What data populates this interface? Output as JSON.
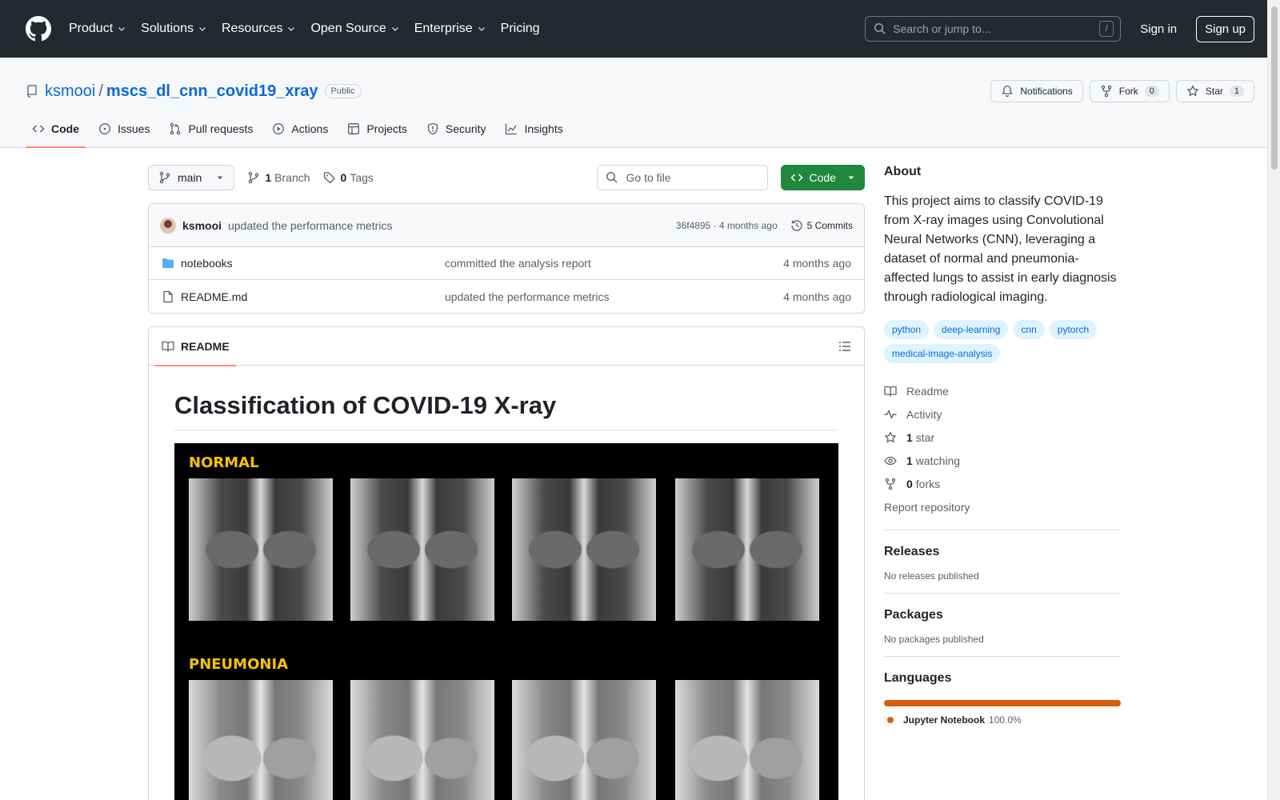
{
  "header": {
    "nav": [
      "Product",
      "Solutions",
      "Resources",
      "Open Source",
      "Enterprise",
      "Pricing"
    ],
    "search_placeholder": "Search or jump to...",
    "search_kbd": "/",
    "signin": "Sign in",
    "signup": "Sign up"
  },
  "repo": {
    "owner": "ksmooi",
    "sep": "/",
    "name": "mscs_dl_cnn_covid19_xray",
    "visibility": "Public",
    "notifications": "Notifications",
    "fork_label": "Fork",
    "fork_count": "0",
    "star_label": "Star",
    "star_count": "1"
  },
  "tabs": [
    "Code",
    "Issues",
    "Pull requests",
    "Actions",
    "Projects",
    "Security",
    "Insights"
  ],
  "filebar": {
    "branch": "main",
    "branch_count": "1",
    "branch_label": "Branch",
    "tag_count": "0",
    "tag_label": "Tags",
    "gofile_placeholder": "Go to file",
    "code_label": "Code"
  },
  "commit": {
    "user": "ksmooi",
    "message": "updated the performance metrics",
    "meta": "36f4895 · 4 months ago",
    "commits": "5 Commits"
  },
  "files": [
    {
      "name": "notebooks",
      "message": "committed the analysis report",
      "date": "4 months ago"
    },
    {
      "name": "README.md",
      "message": "updated the performance metrics",
      "date": "4 months ago"
    }
  ],
  "readme": {
    "tab": "README",
    "title": "Classification of COVID-19 X-ray",
    "label_normal": "NORMAL",
    "label_pneumonia": "PNEUMONIA"
  },
  "about": {
    "title": "About",
    "description": "This project aims to classify COVID-19 from X-ray images using Convolutional Neural Networks (CNN), leveraging a dataset of normal and pneumonia-affected lungs to assist in early diagnosis through radiological imaging.",
    "topics": [
      "python",
      "deep-learning",
      "cnn",
      "pytorch",
      "medical-image-analysis"
    ],
    "readme": "Readme",
    "activity": "Activity",
    "stars_count": "1",
    "stars_label": "star",
    "watching_count": "1",
    "watching_label": "watching",
    "forks_count": "0",
    "forks_label": "forks",
    "report": "Report repository"
  },
  "releases": {
    "title": "Releases",
    "text": "No releases published"
  },
  "packages": {
    "title": "Packages",
    "text": "No packages published"
  },
  "languages": {
    "title": "Languages",
    "name": "Jupyter Notebook",
    "percent": "100.0%",
    "color": "#da5b0b"
  }
}
